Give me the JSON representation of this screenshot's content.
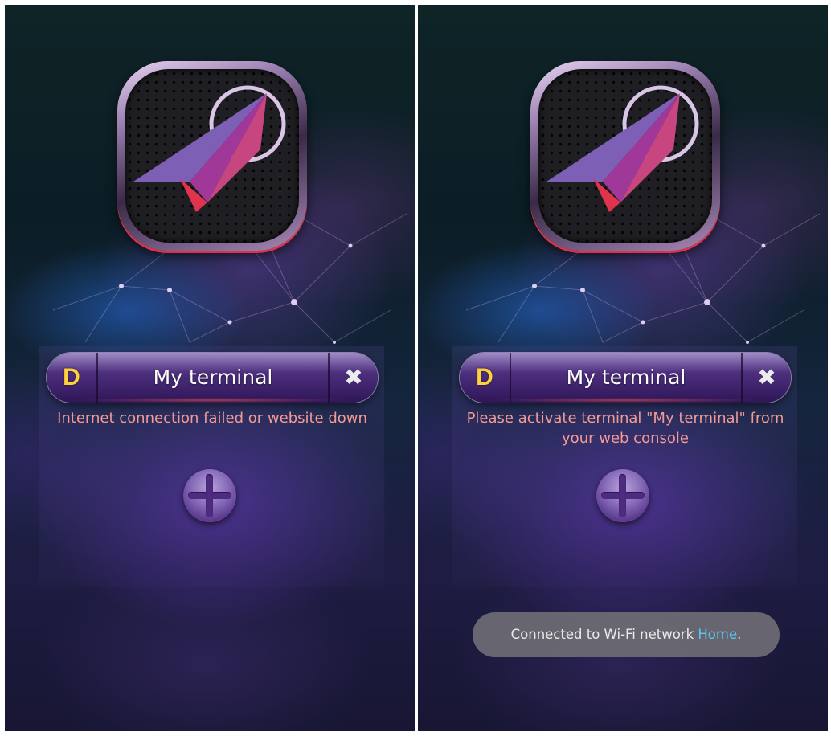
{
  "colors": {
    "accent_yellow": "#ffd23c",
    "status_text": "#f59a92",
    "toast_highlight": "#5ac8f0",
    "toast_bg": "#6e6c74"
  },
  "left_screen": {
    "app_icon": "paper-plane-icon",
    "terminal": {
      "badge": "D",
      "name": "My terminal",
      "remove_icon": "close-icon",
      "remove_glyph": "✖"
    },
    "status_message": "Internet connection failed or website down",
    "add_icon": "plus-icon"
  },
  "right_screen": {
    "app_icon": "paper-plane-icon",
    "terminal": {
      "badge": "D",
      "name": "My terminal",
      "remove_icon": "close-icon",
      "remove_glyph": "✖"
    },
    "status_message": "Please activate terminal \"My terminal\" from your web console",
    "add_icon": "plus-icon",
    "toast": {
      "prefix": "Connected to Wi-Fi network ",
      "network": "Home",
      "suffix": "."
    }
  }
}
